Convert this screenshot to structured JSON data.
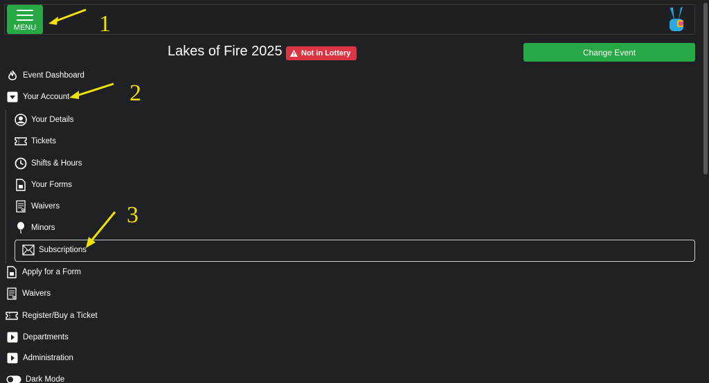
{
  "topbar": {
    "menu_label": "MENU",
    "logo_icon": "peace-hand-logo"
  },
  "header": {
    "event_title": "Lakes of Fire 2025",
    "badge": "Not in Lottery",
    "change_event": "Change Event"
  },
  "nav": {
    "event_dashboard": "Event Dashboard",
    "your_account": "Your Account",
    "account_items": {
      "your_details": "Your Details",
      "tickets": "Tickets",
      "shifts": "Shifts & Hours",
      "your_forms": "Your Forms",
      "waivers": "Waivers",
      "minors": "Minors",
      "subscriptions": "Subscriptions"
    },
    "apply_form": "Apply for a Form",
    "waivers": "Waivers",
    "register": "Register/Buy a Ticket",
    "departments": "Departments",
    "administration": "Administration",
    "dark_mode": "Dark Mode"
  },
  "annotations": {
    "one": "1",
    "two": "2",
    "three": "3"
  },
  "colors": {
    "accent_green": "#28a745",
    "danger_red": "#dc3545",
    "annotation_yellow": "#f2e200",
    "background": "#202124"
  }
}
